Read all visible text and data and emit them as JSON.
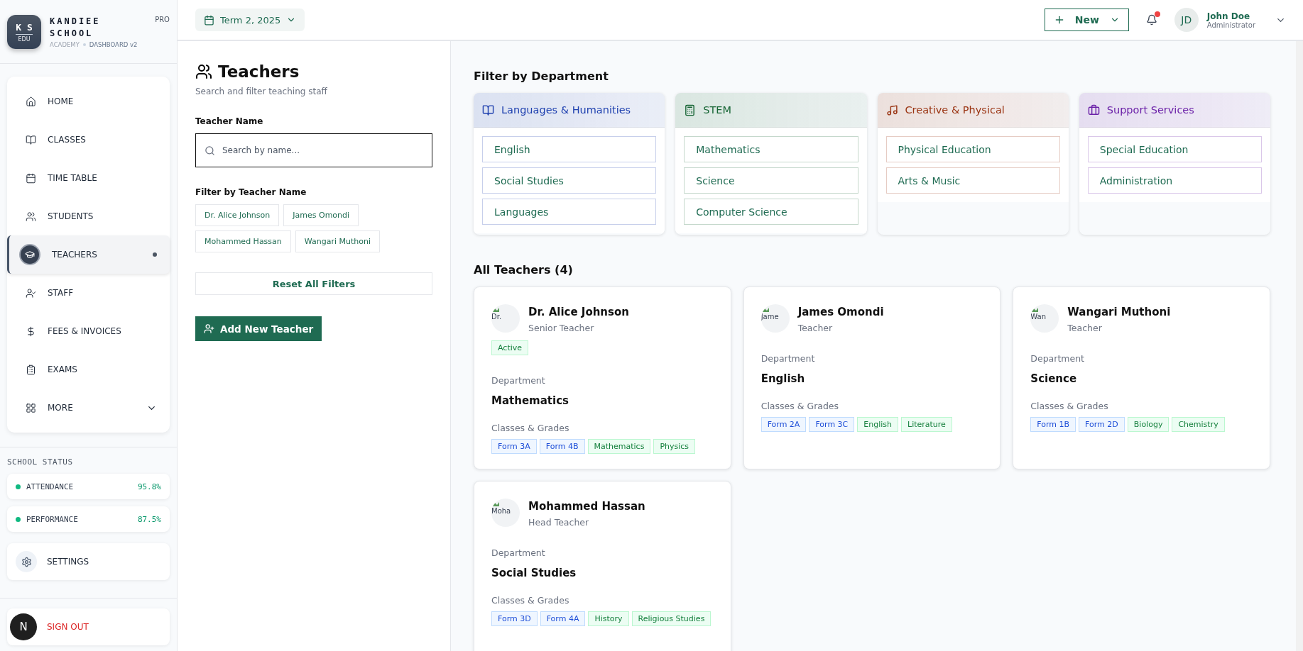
{
  "brand": {
    "logo_top": "K S",
    "logo_bottom": "EDU",
    "name_line1": "KANDIEE",
    "name_line2": "SCHOOL",
    "badge": "PRO",
    "sub_left": "ACADEMY",
    "sub_right": "DASHBOARD v2"
  },
  "nav": [
    {
      "label": "HOME",
      "kind": "link",
      "selected": false
    },
    {
      "label": "CLASSES",
      "kind": "link",
      "selected": false
    },
    {
      "label": "TIME TABLE",
      "kind": "link",
      "selected": false
    },
    {
      "label": "STUDENTS",
      "kind": "link",
      "selected": false
    },
    {
      "label": "TEACHERS",
      "kind": "link",
      "selected": true
    },
    {
      "label": "STAFF",
      "kind": "link",
      "selected": false
    },
    {
      "label": "FEES & INVOICES",
      "kind": "link",
      "selected": false
    },
    {
      "label": "EXAMS",
      "kind": "link",
      "selected": false
    },
    {
      "label": "MORE",
      "kind": "dropdown",
      "selected": false
    }
  ],
  "status": {
    "title": "SCHOOL STATUS",
    "items": [
      {
        "label": "ATTENDANCE",
        "value": "95.8%",
        "color": "#10b981"
      },
      {
        "label": "PERFORMANCE",
        "value": "87.5%",
        "color": "#10b981"
      }
    ]
  },
  "settings": {
    "label": "SETTINGS"
  },
  "sign_out": {
    "label": "SIGN OUT",
    "avatar": "N"
  },
  "header": {
    "term": "Term 2, 2025",
    "new_button": "New",
    "unread": true,
    "user": {
      "initials": "JD",
      "name": "John Doe",
      "role": "Administrator"
    }
  },
  "filters": {
    "title": "Teachers",
    "subtitle": "Search and filter teaching staff",
    "name_label": "Teacher Name",
    "search_placeholder": "Search by name...",
    "chips_label": "Filter by Teacher Name",
    "chips": [
      {
        "label": "Dr. Alice Johnson",
        "selected": false
      },
      {
        "label": "James Omondi",
        "selected": false
      },
      {
        "label": "Mohammed Hassan",
        "selected": false
      },
      {
        "label": "Wangari Muthoni",
        "selected": false
      }
    ],
    "reset": "Reset All Filters",
    "add": "Add New Teacher"
  },
  "departments": {
    "title": "Filter by Department",
    "groups": [
      {
        "name": "Languages & Humanities",
        "color": "#1e40af",
        "subjects": [
          {
            "label": "English",
            "selected": false
          },
          {
            "label": "Social Studies",
            "selected": false
          },
          {
            "label": "Languages",
            "selected": false
          }
        ]
      },
      {
        "name": "STEM",
        "color": "#166534",
        "subjects": [
          {
            "label": "Mathematics",
            "selected": false
          },
          {
            "label": "Science",
            "selected": false
          },
          {
            "label": "Computer Science",
            "selected": false
          }
        ]
      },
      {
        "name": "Creative & Physical",
        "color": "#9a3412",
        "subjects": [
          {
            "label": "Physical Education",
            "selected": false
          },
          {
            "label": "Arts & Music",
            "selected": false
          }
        ]
      },
      {
        "name": "Support Services",
        "color": "#6b21a8",
        "subjects": [
          {
            "label": "Special Education",
            "selected": false
          },
          {
            "label": "Administration",
            "selected": false
          }
        ]
      }
    ]
  },
  "teachers": {
    "title": "All Teachers (4)",
    "cards": [
      {
        "avatar_text": "Dr.",
        "name": "Dr. Alice Johnson",
        "role": "Senior Teacher",
        "status": "Active",
        "department_label": "Department",
        "department": "Mathematics",
        "classes_label": "Classes & Grades",
        "tags": [
          {
            "label": "Form 3A",
            "kind": "class"
          },
          {
            "label": "Form 4B",
            "kind": "class"
          },
          {
            "label": "Mathematics",
            "kind": "subject"
          },
          {
            "label": "Physics",
            "kind": "subject"
          }
        ]
      },
      {
        "avatar_text": "Jame",
        "name": "James Omondi",
        "role": "Teacher",
        "department_label": "Department",
        "department": "English",
        "classes_label": "Classes & Grades",
        "tags": [
          {
            "label": "Form 2A",
            "kind": "class"
          },
          {
            "label": "Form 3C",
            "kind": "class"
          },
          {
            "label": "English",
            "kind": "subject"
          },
          {
            "label": "Literature",
            "kind": "subject"
          }
        ]
      },
      {
        "avatar_text": "Wan",
        "name": "Wangari Muthoni",
        "role": "Teacher",
        "department_label": "Department",
        "department": "Science",
        "classes_label": "Classes & Grades",
        "tags": [
          {
            "label": "Form 1B",
            "kind": "class"
          },
          {
            "label": "Form 2D",
            "kind": "class"
          },
          {
            "label": "Biology",
            "kind": "subject"
          },
          {
            "label": "Chemistry",
            "kind": "subject"
          }
        ]
      },
      {
        "avatar_text": "Moha",
        "name": "Mohammed Hassan",
        "role": "Head Teacher",
        "department_label": "Department",
        "department": "Social Studies",
        "classes_label": "Classes & Grades",
        "tags": [
          {
            "label": "Form 3D",
            "kind": "class"
          },
          {
            "label": "Form 4A",
            "kind": "class"
          },
          {
            "label": "History",
            "kind": "subject"
          },
          {
            "label": "Religious Studies",
            "kind": "subject"
          }
        ]
      }
    ]
  }
}
